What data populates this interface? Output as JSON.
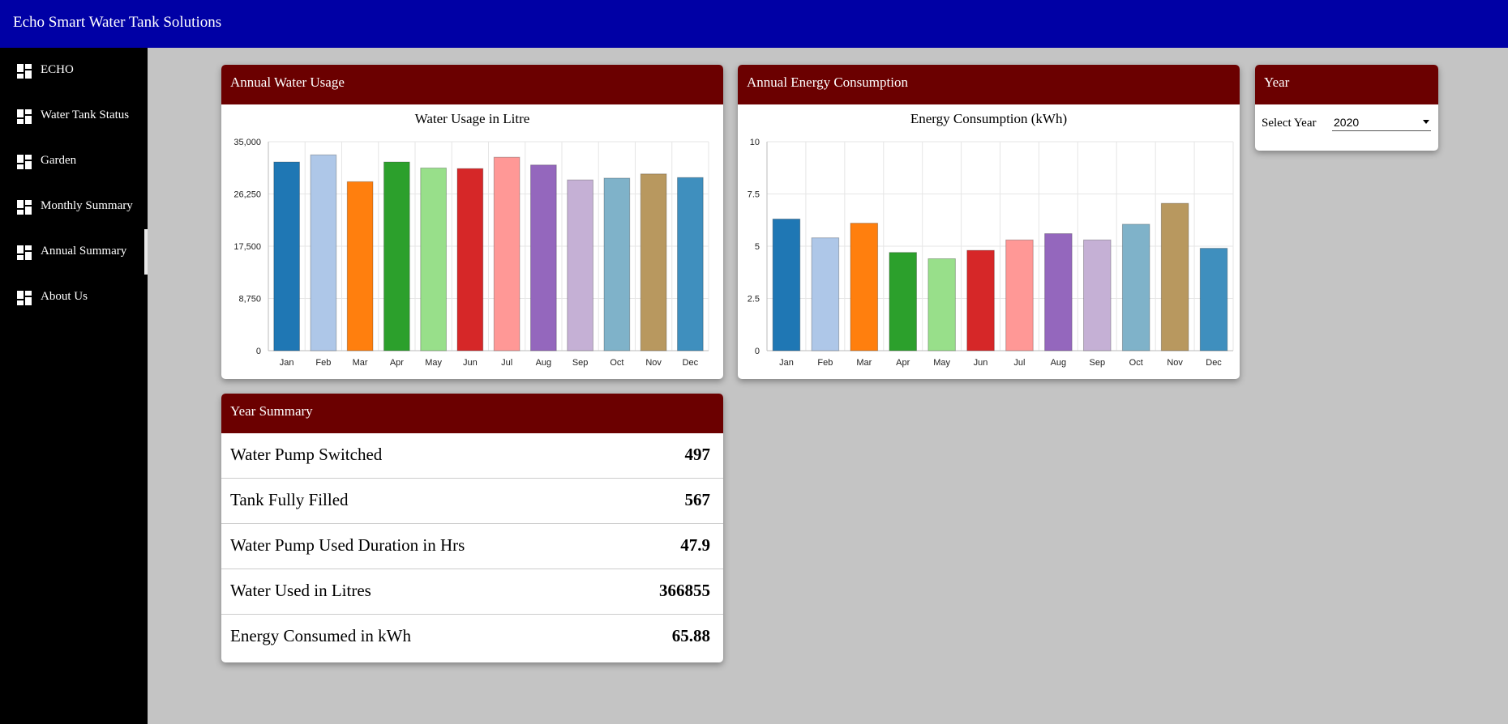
{
  "app": {
    "title": "Echo Smart Water Tank Solutions"
  },
  "sidebar": {
    "items": [
      {
        "label": "ECHO",
        "icon": "dashboard-icon",
        "active": false
      },
      {
        "label": "Water Tank Status",
        "icon": "dashboard-icon",
        "active": false
      },
      {
        "label": "Garden",
        "icon": "dashboard-icon",
        "active": false
      },
      {
        "label": "Monthly Summary",
        "icon": "dashboard-icon",
        "active": false
      },
      {
        "label": "Annual Summary",
        "icon": "dashboard-icon",
        "active": true
      },
      {
        "label": "About Us",
        "icon": "dashboard-icon",
        "active": false
      }
    ]
  },
  "water_card": {
    "title": "Annual Water Usage"
  },
  "energy_card": {
    "title": "Annual Energy Consumption"
  },
  "year_card": {
    "title": "Year",
    "select_label": "Select Year",
    "selected_year": "2020"
  },
  "summary_card": {
    "title": "Year Summary",
    "rows": [
      {
        "label": "Water Pump Switched",
        "value": "497"
      },
      {
        "label": "Tank Fully Filled",
        "value": "567"
      },
      {
        "label": "Water Pump Used Duration in Hrs",
        "value": "47.9"
      },
      {
        "label": "Water Used in Litres",
        "value": "366855"
      },
      {
        "label": "Energy Consumed in kWh",
        "value": "65.88"
      }
    ]
  },
  "palette": [
    "#1f77b4",
    "#aec7e8",
    "#ff7f0e",
    "#2ca02c",
    "#98df8a",
    "#d62728",
    "#ff9896",
    "#9467bd",
    "#c5b0d5",
    "#7fb2c9",
    "#b8985f",
    "#3f8fbe"
  ],
  "chart_data": [
    {
      "type": "bar",
      "title": "Water Usage in Litre",
      "categories": [
        "Jan",
        "Feb",
        "Mar",
        "Apr",
        "May",
        "Jun",
        "Jul",
        "Aug",
        "Sep",
        "Oct",
        "Nov",
        "Dec"
      ],
      "values": [
        31600,
        32800,
        28300,
        31600,
        30600,
        30500,
        32400,
        31100,
        28600,
        28900,
        29600,
        29000
      ],
      "yticks": [
        "0",
        "8,750",
        "17,500",
        "26,250",
        "35,000"
      ],
      "ylim": [
        0,
        35000
      ],
      "grid": true,
      "legend": "none"
    },
    {
      "type": "bar",
      "title": "Energy Consumption (kWh)",
      "categories": [
        "Jan",
        "Feb",
        "Mar",
        "Apr",
        "May",
        "Jun",
        "Jul",
        "Aug",
        "Sep",
        "Oct",
        "Nov",
        "Dec"
      ],
      "values": [
        6.3,
        5.4,
        6.1,
        4.7,
        4.4,
        4.8,
        5.3,
        5.6,
        5.3,
        6.05,
        7.05,
        4.9
      ],
      "yticks": [
        "0",
        "2.5",
        "5",
        "7.5",
        "10"
      ],
      "ylim": [
        0,
        10
      ],
      "grid": true,
      "legend": "none"
    }
  ]
}
